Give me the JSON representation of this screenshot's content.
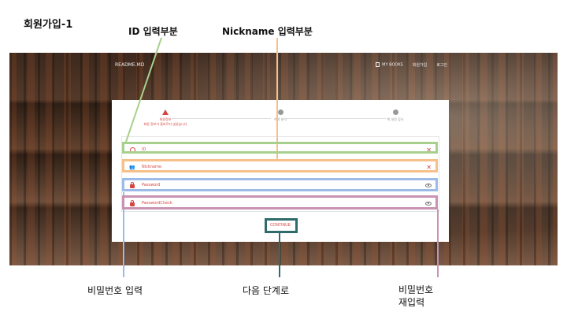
{
  "doc": {
    "title": "회원가입-1"
  },
  "annotations": {
    "id_area": "ID 입력부분",
    "nickname_area": "Nickname 입력부분",
    "password_input": "비밀번호 입력",
    "next_step": "다음 단계로",
    "password_confirm_line1": "비밀번호",
    "password_confirm_line2": "재입력"
  },
  "app": {
    "brand": "README.MD",
    "nav": [
      "MY BOOKS",
      "회원가입",
      "로그인"
    ]
  },
  "steps": [
    {
      "label": "회원정보",
      "sub": "회원 정보가 올바르지 않았습니다",
      "active": true
    },
    {
      "label": "취향 분석",
      "sub": "",
      "active": false
    },
    {
      "label": "책 설정 감사",
      "sub": "",
      "active": false
    }
  ],
  "form": {
    "id_placeholder": "ID",
    "nickname_placeholder": "Nickname",
    "password_placeholder": "Password",
    "password_check_placeholder": "PasswordCheck",
    "continue_label": "CONTINUE"
  },
  "colors": {
    "accent": "#d64541",
    "highlight_id": "#a8d08d",
    "highlight_nickname": "#f6c08a",
    "highlight_password": "#9dbbe8",
    "highlight_password_check": "#c893b3",
    "highlight_continue": "#2f6b6b"
  },
  "icons": {
    "id": "user-circle-icon",
    "nickname": "users-icon",
    "password": "lock-icon",
    "password_check": "lock-icon",
    "clear": "close-icon",
    "reveal": "eye-icon"
  }
}
